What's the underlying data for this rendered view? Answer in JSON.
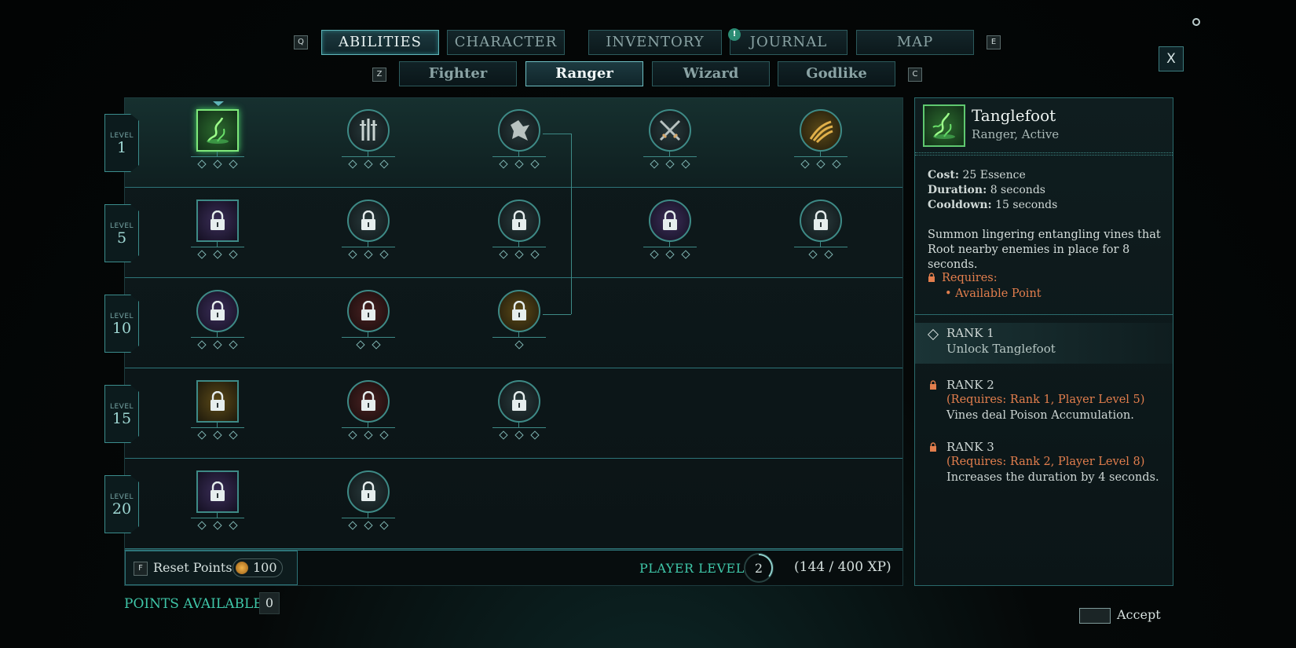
{
  "nav": {
    "left_key": "Q",
    "right_key": "E",
    "tabs": [
      {
        "label": "ABILITIES",
        "active": true
      },
      {
        "label": "CHARACTER",
        "active": false
      },
      {
        "label": "INVENTORY",
        "active": false
      },
      {
        "label": "JOURNAL",
        "active": false,
        "badge": "!"
      },
      {
        "label": "MAP",
        "active": false
      }
    ]
  },
  "subnav": {
    "left_key": "Z",
    "right_key": "C",
    "tabs": [
      {
        "label": "Fighter",
        "active": false
      },
      {
        "label": "Ranger",
        "active": true
      },
      {
        "label": "Wizard",
        "active": false
      },
      {
        "label": "Godlike",
        "active": false
      }
    ]
  },
  "close_label": "X",
  "tree": {
    "level_word": "LEVEL",
    "rows": [
      {
        "level": "1",
        "nodes": [
          {
            "icon": "tanglefoot-icon",
            "shape": "square",
            "state": "selected",
            "ranks": 3
          },
          {
            "icon": "weapons-icon",
            "shape": "circle",
            "state": "unlocked",
            "ranks": 3
          },
          {
            "icon": "shatter-icon",
            "shape": "circle",
            "state": "unlocked",
            "ranks": 3
          },
          {
            "icon": "crossed-swords-icon",
            "shape": "circle",
            "state": "unlocked",
            "ranks": 3
          },
          {
            "icon": "claw-icon",
            "shape": "circle",
            "state": "unlocked",
            "tint": "gold",
            "ranks": 3
          }
        ]
      },
      {
        "level": "5",
        "nodes": [
          {
            "icon": "lock-icon",
            "shape": "square",
            "state": "locked",
            "tint": "purple",
            "ranks": 3
          },
          {
            "icon": "lock-icon",
            "shape": "circle",
            "state": "locked",
            "ranks": 3
          },
          {
            "icon": "lock-icon",
            "shape": "circle",
            "state": "locked",
            "ranks": 3
          },
          {
            "icon": "lock-icon",
            "shape": "circle",
            "state": "locked",
            "tint": "purple",
            "ranks": 3
          },
          {
            "icon": "lock-icon",
            "shape": "circle",
            "state": "locked",
            "ranks": 2
          }
        ]
      },
      {
        "level": "10",
        "nodes": [
          {
            "icon": "lock-icon",
            "shape": "circle",
            "state": "locked",
            "tint": "purple",
            "ranks": 3
          },
          {
            "icon": "lock-icon",
            "shape": "circle",
            "state": "locked",
            "tint": "red",
            "ranks": 2
          },
          {
            "icon": "lock-icon",
            "shape": "circle",
            "state": "locked",
            "tint": "gold",
            "ranks": 1
          }
        ]
      },
      {
        "level": "15",
        "nodes": [
          {
            "icon": "lock-icon",
            "shape": "square",
            "state": "locked",
            "tint": "gold",
            "ranks": 3
          },
          {
            "icon": "lock-icon",
            "shape": "circle",
            "state": "locked",
            "tint": "red",
            "ranks": 3
          },
          {
            "icon": "lock-icon",
            "shape": "circle",
            "state": "locked",
            "ranks": 3
          }
        ]
      },
      {
        "level": "20",
        "nodes": [
          {
            "icon": "lock-icon",
            "shape": "square",
            "state": "locked",
            "tint": "purple",
            "ranks": 3
          },
          {
            "icon": "lock-icon",
            "shape": "circle",
            "state": "locked",
            "ranks": 3
          }
        ]
      }
    ]
  },
  "bottom": {
    "reset_key": "F",
    "reset_label": "Reset Points",
    "reset_cost": "100",
    "player_level_label": "PLAYER LEVEL",
    "player_level": "2",
    "xp": "(144 / 400 XP)",
    "xp_progress": 0.36,
    "points_label": "POINTS AVAILABLE",
    "points_value": "0"
  },
  "details": {
    "name": "Tanglefoot",
    "subtitle": "Ranger, Active",
    "cost_label": "Cost:",
    "cost_value": "25 Essence",
    "duration_label": "Duration:",
    "duration_value": "8 seconds",
    "cooldown_label": "Cooldown:",
    "cooldown_value": "15 seconds",
    "description": "Summon lingering entangling vines that Root nearby enemies in place for 8 seconds.",
    "requires_label": "Requires:",
    "requires_item": "• Available Point",
    "ranks": [
      {
        "title": "RANK 1",
        "req": "",
        "desc": "Unlock Tanglefoot",
        "locked": false
      },
      {
        "title": "RANK 2",
        "req": "(Requires: Rank 1, Player Level 5)",
        "desc": "Vines deal Poison Accumulation.",
        "locked": true
      },
      {
        "title": "RANK 3",
        "req": "(Requires: Rank 2, Player Level 8)",
        "desc": "Increases the duration by 4 seconds.",
        "locked": true
      }
    ]
  },
  "accept_label": "Accept",
  "colors": {
    "accent": "#3e8a86",
    "highlight": "#7ee87a",
    "warning": "#e27e4d"
  }
}
